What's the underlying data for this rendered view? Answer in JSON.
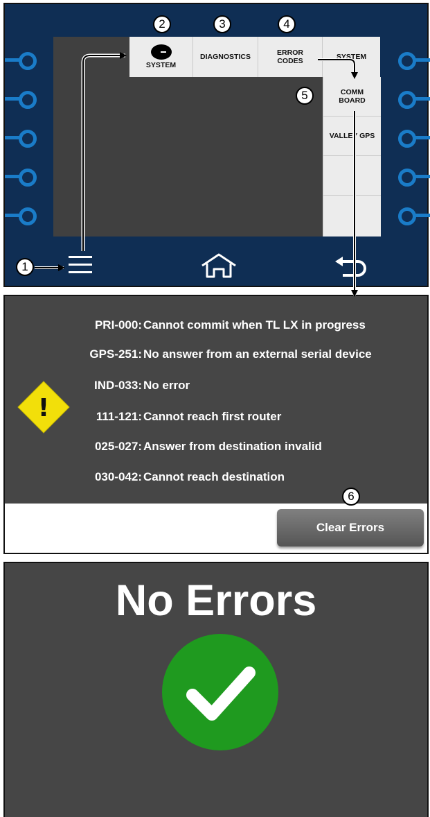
{
  "panel1": {
    "top_menu": {
      "system_label": "SYSTEM",
      "diagnostics_label": "DIAGNOSTICS",
      "error_codes_line1": "ERROR",
      "error_codes_line2": "CODES",
      "system2_label": "SYSTEM"
    },
    "side_menu": {
      "comm_line1": "COMM",
      "comm_line2": "BOARD",
      "valley_gps_label": "VALLEY GPS"
    },
    "bottom_bar": {
      "menu_icon": "hamburger-menu-icon",
      "home_icon": "home-icon",
      "back_icon": "back-arrow-icon"
    },
    "callouts": [
      "1",
      "2",
      "3",
      "4",
      "5"
    ]
  },
  "panel2": {
    "errors": [
      {
        "code": "PRI-000:",
        "message": "Cannot commit when TL LX in progress"
      },
      {
        "code": "GPS-251:",
        "message": "No answer from an external serial device"
      },
      {
        "code": "IND-033:",
        "message": "No error"
      },
      {
        "code": "111-121:",
        "message": "Cannot reach first router"
      },
      {
        "code": "025-027:",
        "message": "Answer from destination invalid"
      },
      {
        "code": "030-042:",
        "message": "Cannot reach destination"
      }
    ],
    "warning_icon": "warning-diamond-icon",
    "warning_glyph": "!",
    "clear_button_label": "Clear Errors",
    "callout": "6",
    "colors": {
      "warning": "#f2df0a",
      "background": "#464646"
    }
  },
  "panel3": {
    "title": "No Errors",
    "check_icon": "green-checkmark-icon",
    "colors": {
      "check_circle": "#1f9a1f"
    }
  }
}
